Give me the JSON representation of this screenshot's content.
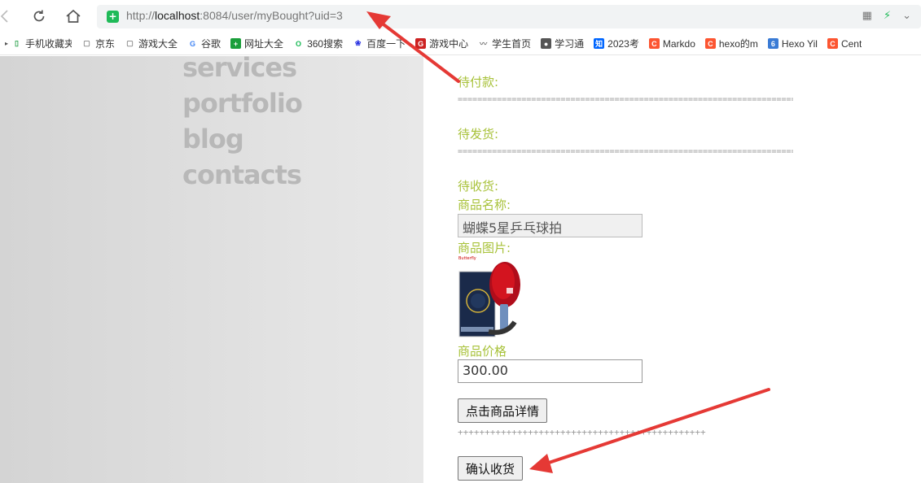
{
  "browser": {
    "url_prefix": "http://",
    "url_host": "localhost",
    "url_rest": ":8084/user/myBought?uid=3"
  },
  "bookmarks": [
    {
      "label": "手机收藏夹",
      "icon": "phone-icon",
      "color": "#2ea44f"
    },
    {
      "label": "京东",
      "icon": "page-icon",
      "color": "#888888"
    },
    {
      "label": "游戏大全",
      "icon": "page-icon",
      "color": "#888888"
    },
    {
      "label": "谷歌",
      "icon": "google-icon",
      "color": "#4285f4"
    },
    {
      "label": "网址大全",
      "icon": "plus-icon",
      "color": "#1a9e3a"
    },
    {
      "label": "360搜索",
      "icon": "search360-icon",
      "color": "#19b955"
    },
    {
      "label": "百度一下",
      "icon": "baidu-paw-icon",
      "color": "#2932e1"
    },
    {
      "label": "游戏中心",
      "icon": "game-center-icon",
      "color": "#cc2222"
    },
    {
      "label": "学生首页",
      "icon": "wave-icon",
      "color": "#777777"
    },
    {
      "label": "学习通",
      "icon": "globe-icon",
      "color": "#555555"
    },
    {
      "label": "2023考",
      "icon": "zhihu-icon",
      "color": "#0066ff"
    },
    {
      "label": "Markdo",
      "icon": "csdn-icon",
      "color": "#fc5531"
    },
    {
      "label": "hexo的m",
      "icon": "csdn-icon",
      "color": "#fc5531"
    },
    {
      "label": "Hexo Yil",
      "icon": "hexo-icon",
      "color": "#3a7bd5"
    },
    {
      "label": "Cent",
      "icon": "csdn-icon",
      "color": "#fc5531"
    }
  ],
  "sidebar_menu": [
    "services",
    "portfolio",
    "blog",
    "contacts"
  ],
  "orders": {
    "pending_payment_label": "待付款:",
    "pending_shipment_label": "待发货:",
    "pending_receipt_label": "待收货:",
    "separator_eq": "========================================================================",
    "separator_plus": "++++++++++++++++++++++++++++++++++++++++++++++",
    "name_label": "商品名称:",
    "name_value": "蝴蝶5星乒乓球拍",
    "image_label": "商品图片:",
    "image_brand": "Butterfly",
    "price_label": "商品价格",
    "price_value": "300.00",
    "detail_button": "点击商品详情",
    "confirm_button": "确认收货"
  },
  "colors": {
    "label_green": "#a8c23a",
    "annotation_red": "#e53935"
  }
}
